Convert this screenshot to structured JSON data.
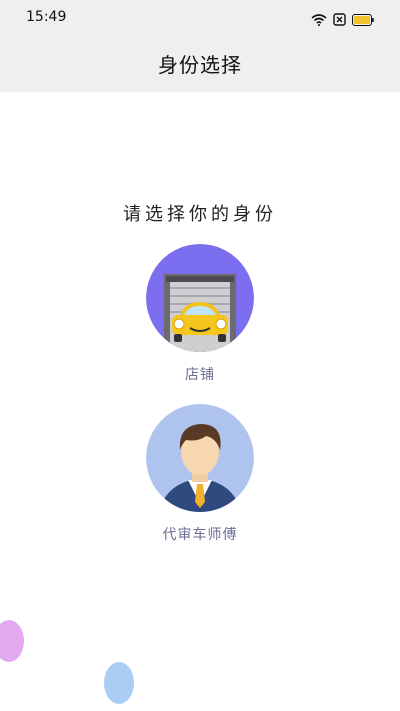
{
  "status_bar": {
    "time": "15:49",
    "icons": [
      "wifi-icon",
      "sim-x-icon",
      "battery-icon"
    ],
    "battery_color": "#f2c12e"
  },
  "header": {
    "title": "身份选择"
  },
  "main": {
    "prompt": "请选择你的身份",
    "roles": [
      {
        "label": "店铺",
        "icon": "car-garage-icon",
        "bg_color": "#7b6ff0"
      },
      {
        "label": "代审车师傅",
        "icon": "mechanic-avatar-icon",
        "bg_color": "#aec4ef"
      }
    ]
  },
  "colors": {
    "header_bg": "#efefef",
    "role_label": "#6a6d92",
    "bubble_pink": "#e2a8f0",
    "bubble_blue": "#a9cdf5"
  }
}
